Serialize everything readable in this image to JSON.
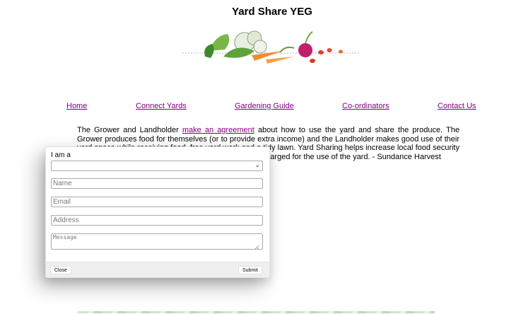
{
  "site": {
    "title": "Yard Share YEG"
  },
  "nav": [
    "Home",
    "Connect Yards",
    "Gardening Guide",
    "Co-ordinators",
    "Contact Us"
  ],
  "intro": {
    "before_link": "The Grower and Landholder ",
    "link": "make an agreement",
    "after_link": " about how to use the yard and share the produce. The Grower produces food for themselves (or to provide extra income) and the Landholder makes good use of their yard space while receiving food, free yard work and a tidy lawn. Yard Sharing helps increase local food security and brings communities together. Sometimes a fee is charged for the use of the yard. - Sundance Harvest"
  },
  "form": {
    "role_label": "I am a",
    "role_value": "",
    "name_placeholder": "Name",
    "email_placeholder": "Email",
    "address_placeholder": "Address",
    "message_placeholder": "Message",
    "close_label": "Close",
    "submit_label": "Submit"
  },
  "icons": {
    "select_arrow": "chevron-down-icon",
    "resize": "resize-grip-icon"
  }
}
